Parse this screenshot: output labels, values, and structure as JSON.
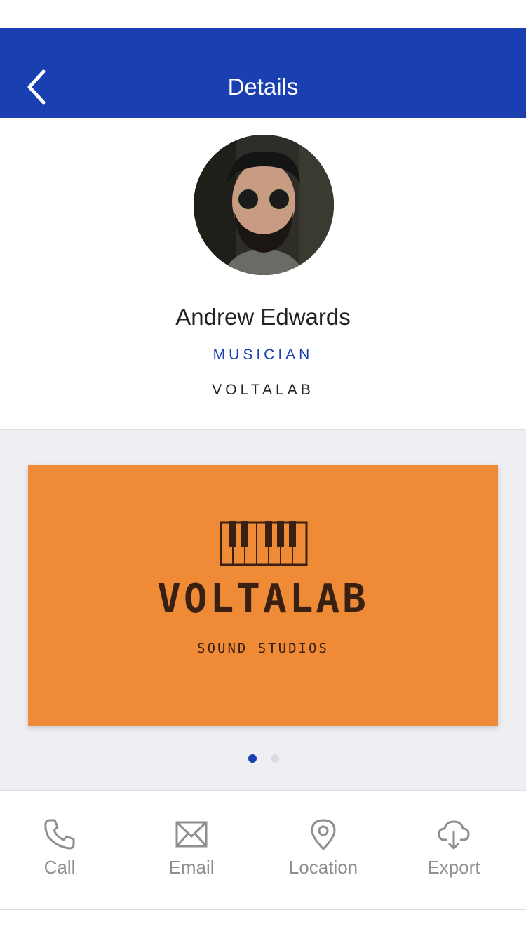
{
  "nav": {
    "title": "Details"
  },
  "profile": {
    "name": "Andrew Edwards",
    "role": "MUSICIAN",
    "company": "VOLTALAB"
  },
  "card": {
    "brand": "VOLTALAB",
    "subtitle": "SOUND STUDIOS",
    "pages": 2,
    "current_page": 1
  },
  "actions": [
    {
      "label": "Call",
      "icon": "phone-icon"
    },
    {
      "label": "Email",
      "icon": "envelope-icon"
    },
    {
      "label": "Location",
      "icon": "map-pin-icon"
    },
    {
      "label": "Export",
      "icon": "cloud-download-icon"
    }
  ],
  "colors": {
    "accent": "#1a3fb0",
    "card_background": "#ef8a36",
    "muted": "#8e8e93"
  }
}
